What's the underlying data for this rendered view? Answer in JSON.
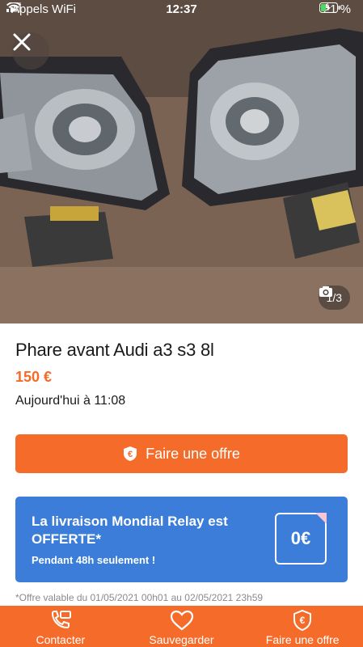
{
  "status_bar": {
    "carrier": "Appels WiFi",
    "time": "12:37",
    "battery": "21 %"
  },
  "gallery": {
    "counter": "1/3"
  },
  "listing": {
    "title": "Phare avant Audi a3 s3 8l",
    "price": "150 €",
    "date": "Aujourd'hui à 11:08"
  },
  "offer_button": {
    "label": "Faire une offre"
  },
  "promo": {
    "headline": "La livraison Mondial Relay est OFFERTE*",
    "subline": "Pendant 48h seulement !",
    "badge": "0€"
  },
  "disclaimer": "*Offre valable du 01/05/2021 00h01 au 02/05/2021 23h59",
  "bottom_bar": {
    "contact": "Contacter",
    "save": "Sauvegarder",
    "offer": "Faire une offre"
  },
  "colors": {
    "accent": "#f56b2a",
    "promo_blue": "#3b7dd8"
  }
}
